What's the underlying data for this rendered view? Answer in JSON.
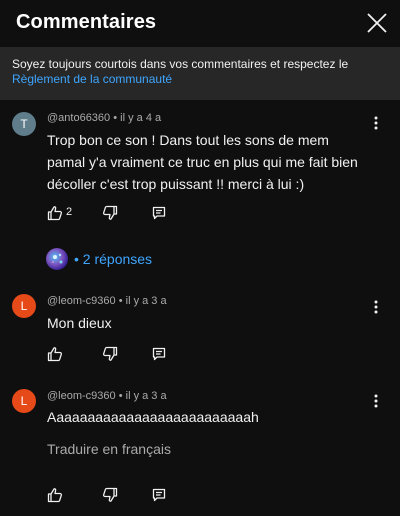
{
  "header": {
    "title": "Commentaires",
    "close_icon": "close-icon"
  },
  "notice": {
    "text": "Soyez toujours courtois dans vos commentaires et respectez le ",
    "link": "Règlement de la communauté"
  },
  "comments": [
    {
      "avatar_letter": "T",
      "avatar_color": "#607d8b",
      "author": "@anto66360",
      "separator": " • ",
      "time": "il y a 4 a",
      "text": "Trop bon ce son ! Dans tout les sons de mem pamal y'a vraiment ce truc en plus qui me fait bien décoller c'est trop puissant !! merci à lui :)",
      "likes": "2",
      "replies_label": "• 2 réponses"
    },
    {
      "avatar_letter": "L",
      "avatar_color": "#e64a19",
      "author": "@leom-c9360",
      "separator": " • ",
      "time": "il y a 3 a",
      "text": "Mon dieux"
    },
    {
      "avatar_letter": "L",
      "avatar_color": "#e64a19",
      "author": "@leom-c9360",
      "separator": " • ",
      "time": "il y a 3 a",
      "text": "Aaaaaaaaaaaaaaaaaaaaaaaaaah",
      "translate": "Traduire en français"
    }
  ],
  "colors": {
    "background": "#0f0f0f",
    "notice_bg": "#272727",
    "link": "#3ea6ff",
    "secondary_text": "#aaaaaa"
  }
}
